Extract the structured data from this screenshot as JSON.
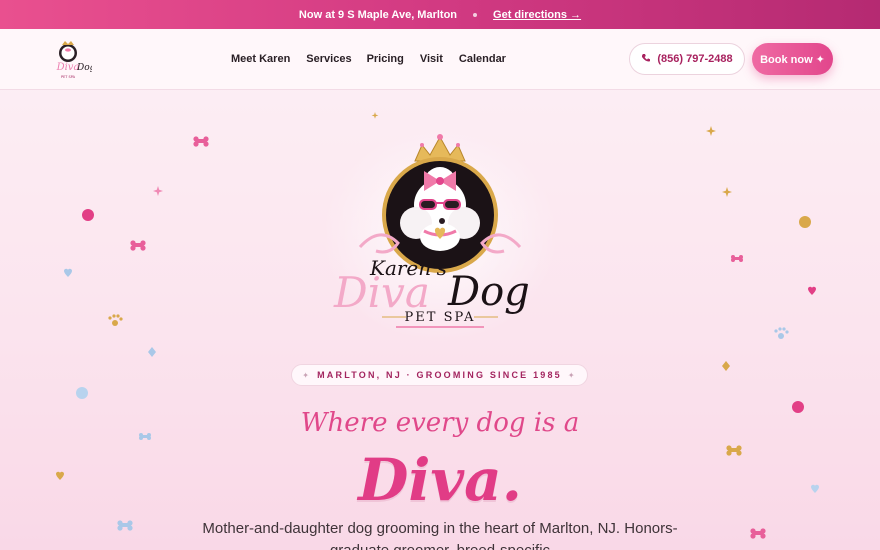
{
  "announcement": {
    "location": "Now at 9 S Maple Ave, Marlton",
    "directions_link": "Get directions →"
  },
  "brand": {
    "logo_script": "Karen's",
    "logo_diva": "Diva",
    "logo_dog": "Dog",
    "logo_sub": "PET SPA"
  },
  "nav": {
    "items": [
      {
        "label": "Meet Karen"
      },
      {
        "label": "Services"
      },
      {
        "label": "Pricing"
      },
      {
        "label": "Visit"
      },
      {
        "label": "Calendar"
      }
    ],
    "phone": "(856) 797-2488",
    "book": "Book now ✦"
  },
  "hero": {
    "badge": "MARLTON, NJ · GROOMING SINCE 1985",
    "tagline": "Where every dog is a",
    "headline": "Diva.",
    "lede": "Mother-and-daughter dog grooming in the heart of Marlton, NJ. Honors-graduate groomer, breed-specific"
  },
  "colors": {
    "accent": "#e13c86",
    "topbar": "#d23a82",
    "badge_text": "#a3245f"
  }
}
